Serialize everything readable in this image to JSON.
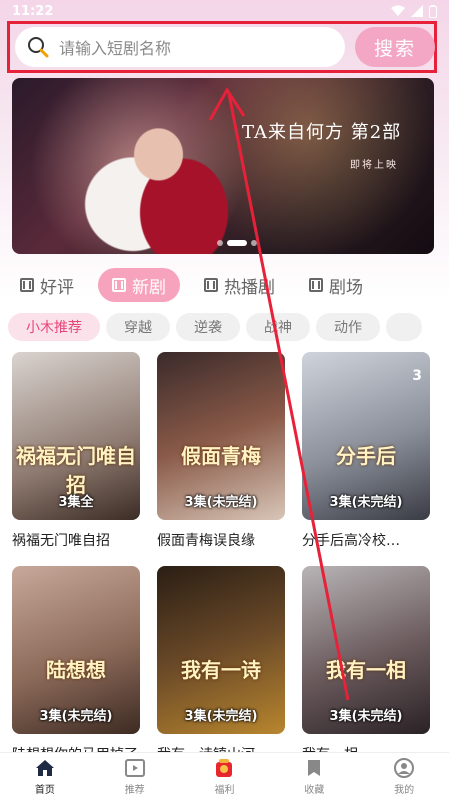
{
  "status": {
    "time": "11:22"
  },
  "search": {
    "placeholder": "请输入短剧名称",
    "button": "搜索"
  },
  "banner": {
    "title": "TA来自何方 第2部",
    "subtitle": "即将上映"
  },
  "tabs": [
    {
      "label": "好评",
      "active": false
    },
    {
      "label": "新剧",
      "active": true
    },
    {
      "label": "热播剧",
      "active": false
    },
    {
      "label": "剧场",
      "active": false
    }
  ],
  "chips": [
    {
      "label": "小木推荐",
      "active": true
    },
    {
      "label": "穿越"
    },
    {
      "label": "逆袭"
    },
    {
      "label": "战神"
    },
    {
      "label": "动作"
    }
  ],
  "cards": [
    {
      "poster_text": "祸福无门唯自招",
      "episodes": "3集全",
      "title": "祸福无门唯自招"
    },
    {
      "poster_text": "假面青梅",
      "episodes": "3集(未完结)",
      "title": "假面青梅误良缘"
    },
    {
      "poster_text": "分手后",
      "episodes": "3集(未完结)",
      "title": "分手后高冷校…",
      "rank": "3"
    },
    {
      "poster_text": "陆想想",
      "episodes": "3集(未完结)",
      "title": "陆想想你的马甲掉了"
    },
    {
      "poster_text": "我有一诗",
      "episodes": "3集(未完结)",
      "title": "我有一诗镇山河"
    },
    {
      "poster_text": "我有一相",
      "episodes": "3集(未完结)",
      "title": "我有一相"
    }
  ],
  "nav": [
    {
      "label": "首页",
      "icon": "home-icon",
      "active": true
    },
    {
      "label": "推荐",
      "icon": "video-icon"
    },
    {
      "label": "福利",
      "icon": "gift-icon"
    },
    {
      "label": "收藏",
      "icon": "bookmark-icon"
    },
    {
      "label": "我的",
      "icon": "user-icon"
    }
  ],
  "colors": {
    "accent": "#f7a3bd",
    "highlight_box": "#e8213a",
    "chip_active_text": "#e8457a"
  }
}
